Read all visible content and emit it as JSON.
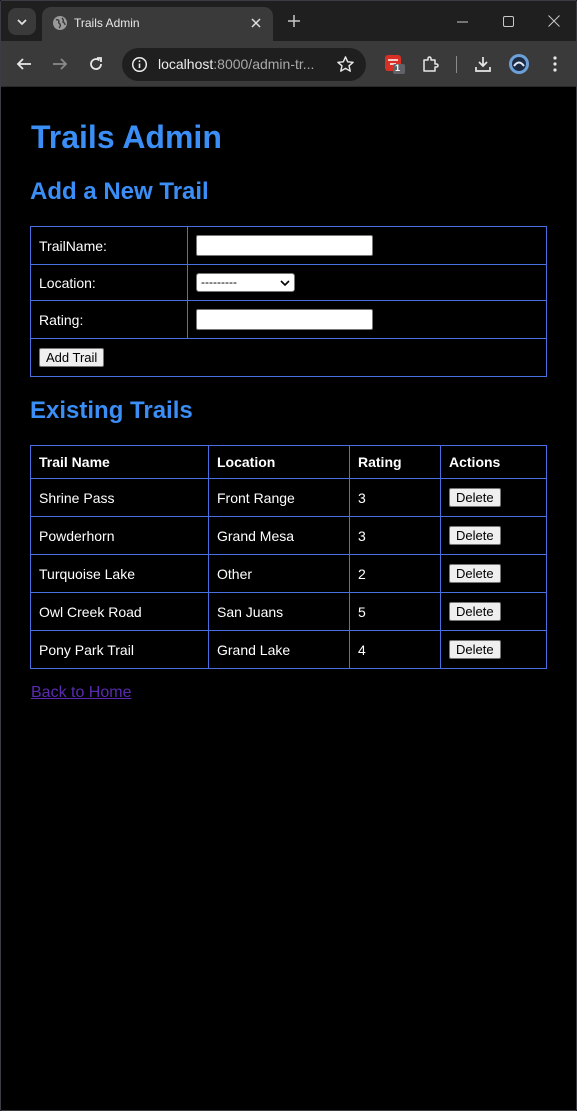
{
  "browser": {
    "tab_title": "Trails Admin",
    "url_host": "localhost",
    "url_rest": ":8000/admin-tr...",
    "extension_badge": "1"
  },
  "page": {
    "title": "Trails Admin",
    "add_heading": "Add a New Trail",
    "form": {
      "trail_name_label": "TrailName:",
      "location_label": "Location:",
      "location_selected": "---------",
      "rating_label": "Rating:",
      "submit_label": "Add Trail"
    },
    "existing_heading": "Existing Trails",
    "table": {
      "headers": [
        "Trail Name",
        "Location",
        "Rating",
        "Actions"
      ],
      "rows": [
        {
          "name": "Shrine Pass",
          "location": "Front Range",
          "rating": "3",
          "action": "Delete"
        },
        {
          "name": "Powderhorn",
          "location": "Grand Mesa",
          "rating": "3",
          "action": "Delete"
        },
        {
          "name": "Turquoise Lake",
          "location": "Other",
          "rating": "2",
          "action": "Delete"
        },
        {
          "name": "Owl Creek Road",
          "location": "San Juans",
          "rating": "5",
          "action": "Delete"
        },
        {
          "name": "Pony Park Trail",
          "location": "Grand Lake",
          "rating": "4",
          "action": "Delete"
        }
      ]
    },
    "back_link": "Back to Home"
  },
  "colors": {
    "heading": "#3a8ef6",
    "table_border": "#4a6fe0",
    "link_visited": "#5a2bb0",
    "background": "#000000"
  },
  "icons": [
    "tab-search-icon",
    "globe-icon",
    "close-icon",
    "plus-icon",
    "minimize-icon",
    "maximize-icon",
    "back-arrow-icon",
    "forward-arrow-icon",
    "reload-icon",
    "site-info-icon",
    "star-icon",
    "extension-icon",
    "puzzle-icon",
    "download-icon",
    "profile-icon",
    "kebab-menu-icon"
  ]
}
